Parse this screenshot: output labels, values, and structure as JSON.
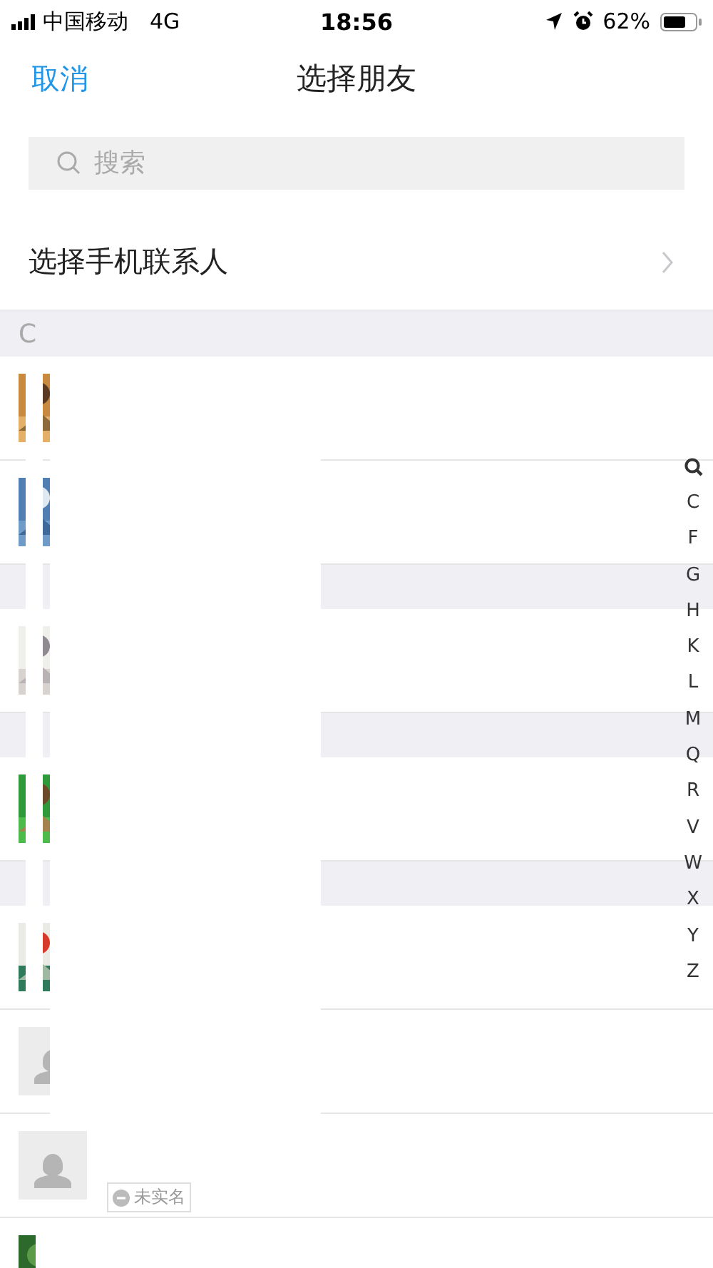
{
  "status_bar": {
    "carrier": "中国移动",
    "network": "4G",
    "time": "18:56",
    "battery": "62%"
  },
  "nav": {
    "cancel": "取消",
    "title": "选择朋友"
  },
  "search": {
    "placeholder": "搜索"
  },
  "phone_contacts": {
    "label": "选择手机联系人"
  },
  "list": [
    {
      "kind": "header",
      "letter": "C"
    },
    {
      "kind": "photo_contact"
    },
    {
      "kind": "photo_contact"
    },
    {
      "kind": "header"
    },
    {
      "kind": "photo_contact"
    },
    {
      "kind": "header"
    },
    {
      "kind": "photo_contact"
    },
    {
      "kind": "header"
    },
    {
      "kind": "photo_contact"
    },
    {
      "kind": "blank_contact"
    },
    {
      "kind": "blank_contact",
      "badge": "未实名"
    },
    {
      "kind": "photo_contact"
    }
  ],
  "index_bar": [
    {
      "kind": "search"
    },
    {
      "kind": "letter",
      "label": "C"
    },
    {
      "kind": "letter",
      "label": "F"
    },
    {
      "kind": "letter",
      "label": "G"
    },
    {
      "kind": "letter",
      "label": "H"
    },
    {
      "kind": "letter",
      "label": "K"
    },
    {
      "kind": "letter",
      "label": "L"
    },
    {
      "kind": "letter",
      "label": "M"
    },
    {
      "kind": "letter",
      "label": "Q"
    },
    {
      "kind": "letter",
      "label": "R"
    },
    {
      "kind": "letter",
      "label": "V"
    },
    {
      "kind": "letter",
      "label": "W"
    },
    {
      "kind": "letter",
      "label": "X"
    },
    {
      "kind": "letter",
      "label": "Y"
    },
    {
      "kind": "letter",
      "label": "Z"
    }
  ]
}
